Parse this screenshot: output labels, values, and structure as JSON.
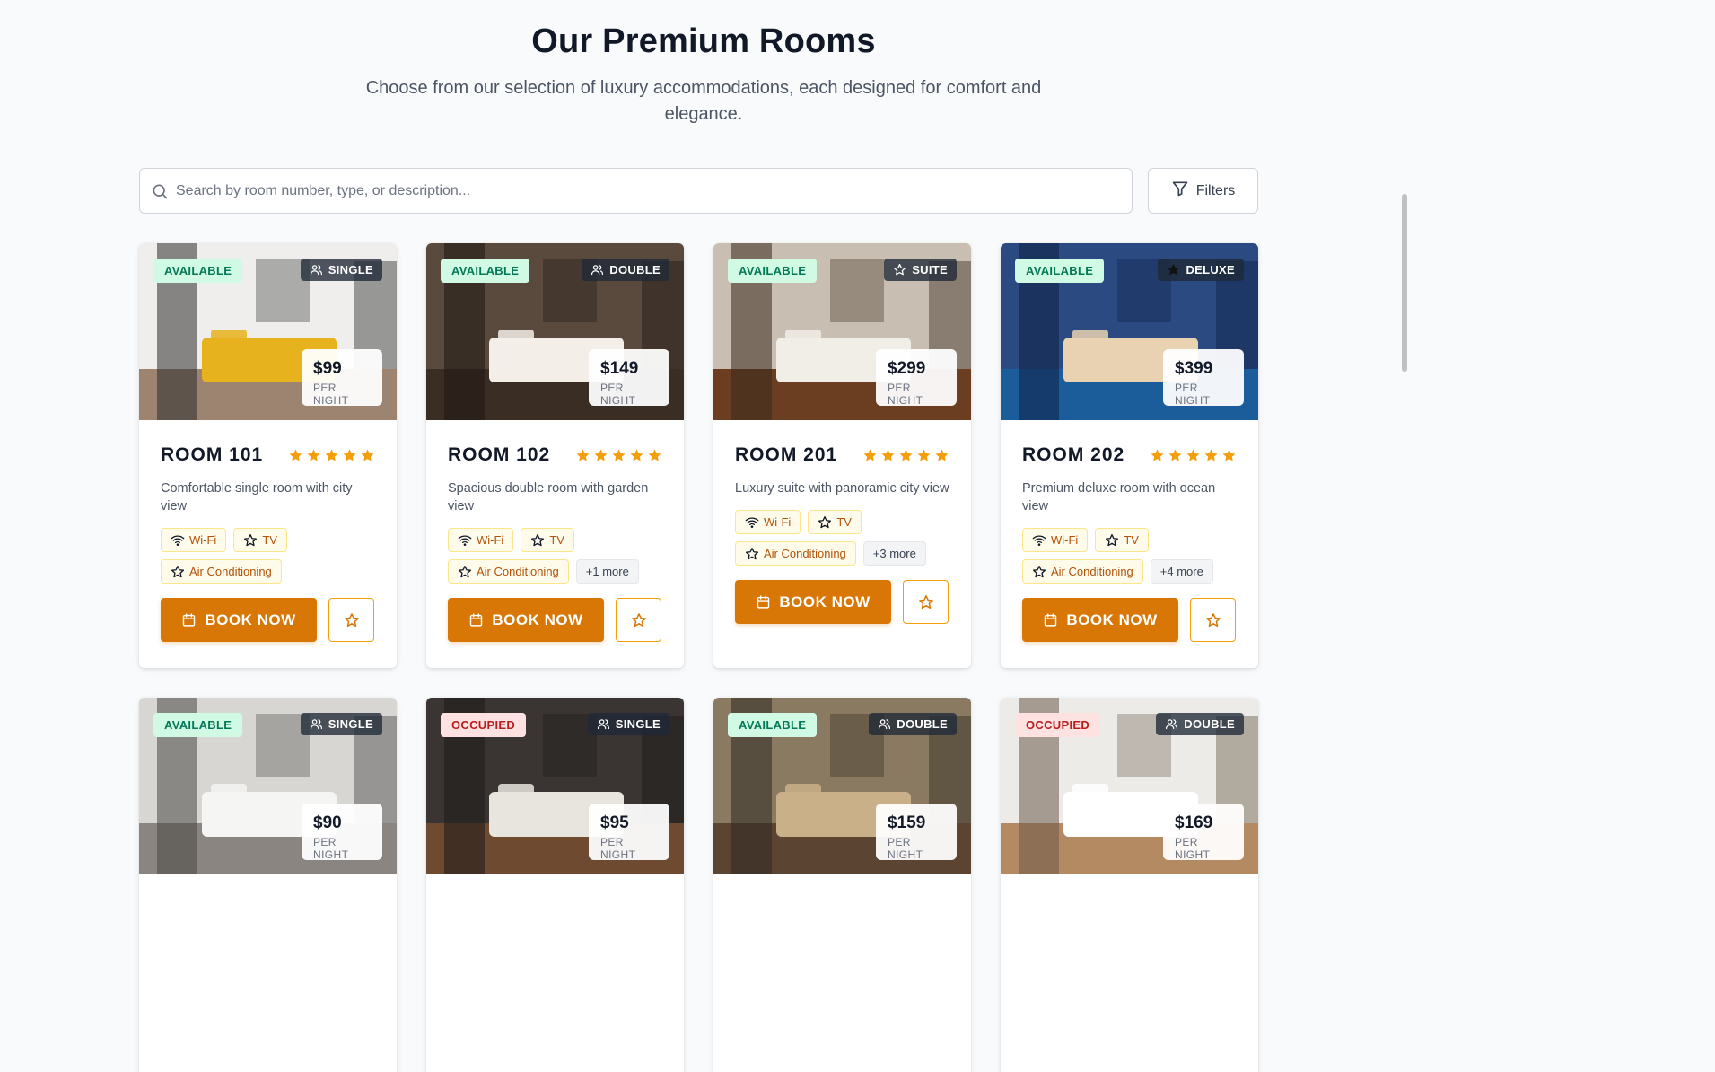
{
  "header": {
    "title": "Our Premium Rooms",
    "subtitle": "Choose from our selection of luxury accommodations, each designed for comfort and elegance."
  },
  "search": {
    "placeholder": "Search by room number, type, or description...",
    "value": "",
    "icon": "search-icon"
  },
  "filters": {
    "label": "Filters",
    "icon": "filter-icon"
  },
  "book_label": "BOOK NOW",
  "price_label": "PER NIGHT",
  "colors": {
    "accent": "#d97706",
    "star": "#f59e0b",
    "available_bg": "#d1fae5",
    "available_text": "#047857",
    "occupied_bg": "#fee2e2",
    "occupied_text": "#b91c1c"
  },
  "rooms": [
    {
      "title": "ROOM 101",
      "status": "AVAILABLE",
      "type": "SINGLE",
      "type_icon": "users-icon",
      "price": "$99",
      "rating": 5,
      "description": "Comfortable single room with city view",
      "amenities": [
        "Wi-Fi",
        "TV",
        "Air Conditioning"
      ],
      "more": "",
      "image": {
        "wall": "#efeeec",
        "floor": "#9c8470",
        "accent": "#e6b21e",
        "dark": "#2d2d2d"
      }
    },
    {
      "title": "ROOM 102",
      "status": "AVAILABLE",
      "type": "DOUBLE",
      "type_icon": "users-icon",
      "price": "$149",
      "rating": 5,
      "description": "Spacious double room with garden view",
      "amenities": [
        "Wi-Fi",
        "TV",
        "Air Conditioning"
      ],
      "more": "+1 more",
      "image": {
        "wall": "#5a4a3e",
        "floor": "#3a2d24",
        "accent": "#f3efe8",
        "dark": "#1f1813"
      }
    },
    {
      "title": "ROOM 201",
      "status": "AVAILABLE",
      "type": "SUITE",
      "type_icon": "star-icon",
      "price": "$299",
      "rating": 5,
      "description": "Luxury suite with panoramic city view",
      "amenities": [
        "Wi-Fi",
        "TV",
        "Air Conditioning"
      ],
      "more": "+3 more",
      "image": {
        "wall": "#c8bfb2",
        "floor": "#6b3e22",
        "accent": "#f1ede7",
        "dark": "#3b2a1e"
      }
    },
    {
      "title": "ROOM 202",
      "status": "AVAILABLE",
      "type": "DELUXE",
      "type_icon": "star-filled-icon",
      "price": "$399",
      "rating": 5,
      "description": "Premium deluxe room with ocean view",
      "amenities": [
        "Wi-Fi",
        "TV",
        "Air Conditioning"
      ],
      "more": "+4 more",
      "image": {
        "wall": "#2b4a82",
        "floor": "#1b5c9b",
        "accent": "#e9d2b1",
        "dark": "#0e2144"
      }
    },
    {
      "title": "",
      "status": "AVAILABLE",
      "type": "SINGLE",
      "type_icon": "users-icon",
      "price": "$90",
      "rating": 0,
      "description": "",
      "amenities": [],
      "more": "",
      "image": {
        "wall": "#d8d6d2",
        "floor": "#8a8580",
        "accent": "#f5f5f3",
        "dark": "#4a4846"
      }
    },
    {
      "title": "",
      "status": "OCCUPIED",
      "type": "SINGLE",
      "type_icon": "users-icon",
      "price": "$95",
      "rating": 0,
      "description": "",
      "amenities": [],
      "more": "",
      "image": {
        "wall": "#3a3532",
        "floor": "#6e4a30",
        "accent": "#e8e4de",
        "dark": "#1c1917"
      }
    },
    {
      "title": "",
      "status": "AVAILABLE",
      "type": "DOUBLE",
      "type_icon": "users-icon",
      "price": "$159",
      "rating": 0,
      "description": "",
      "amenities": [],
      "more": "",
      "image": {
        "wall": "#8a7a62",
        "floor": "#5c4432",
        "accent": "#c9b089",
        "dark": "#2f2a22"
      }
    },
    {
      "title": "",
      "status": "OCCUPIED",
      "type": "DOUBLE",
      "type_icon": "users-icon",
      "price": "$169",
      "rating": 0,
      "description": "",
      "amenities": [],
      "more": "",
      "image": {
        "wall": "#ecebe8",
        "floor": "#b48a62",
        "accent": "#ffffff",
        "dark": "#6b5a48"
      }
    }
  ]
}
